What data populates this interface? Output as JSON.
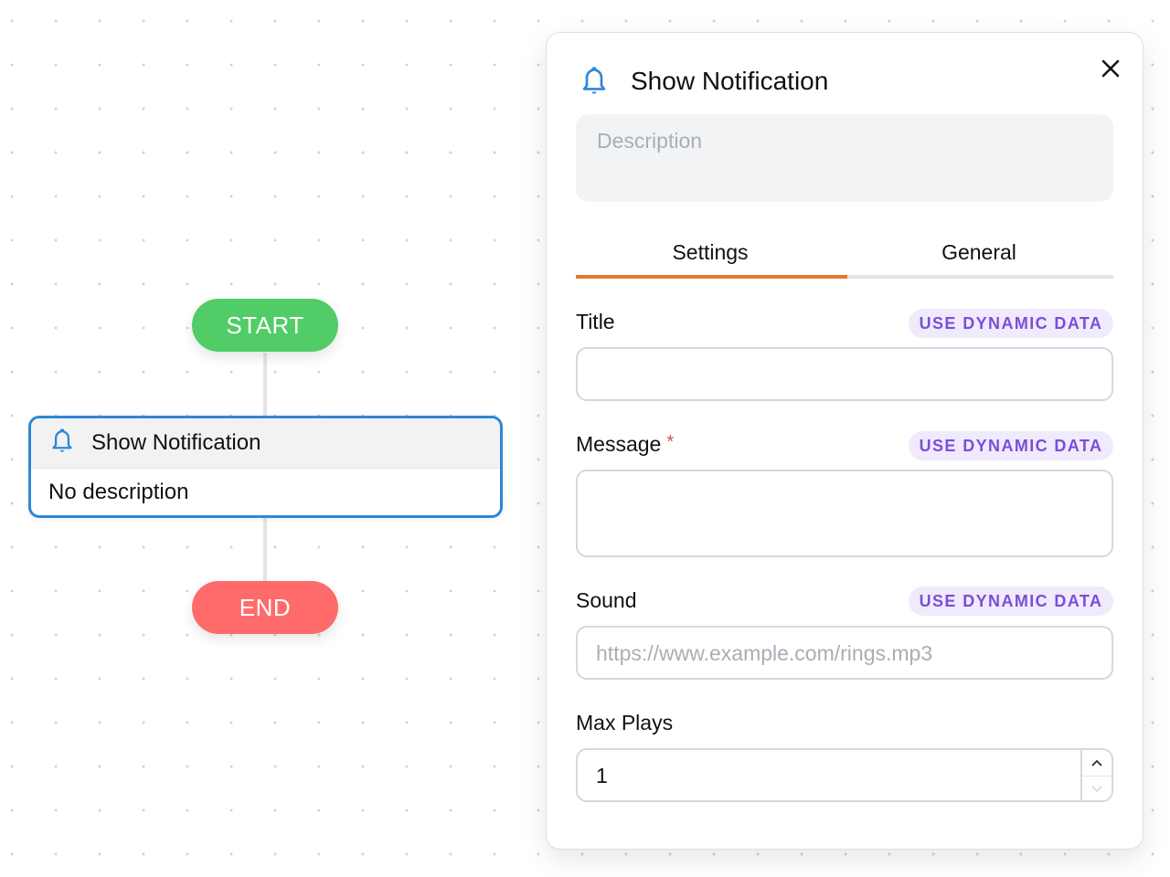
{
  "canvas": {
    "start_label": "START",
    "end_label": "END",
    "node": {
      "title": "Show Notification",
      "description": "No description",
      "icon": "bell-icon"
    }
  },
  "panel": {
    "title": "Show Notification",
    "icon": "bell-icon",
    "close_icon": "close-icon",
    "description_placeholder": "Description",
    "description_value": "",
    "tabs": [
      {
        "label": "Settings",
        "active": true
      },
      {
        "label": "General",
        "active": false
      }
    ],
    "fields": {
      "title": {
        "label": "Title",
        "value": "",
        "dynamic_label": "USE DYNAMIC DATA"
      },
      "message": {
        "label": "Message",
        "required_mark": "*",
        "value": "",
        "dynamic_label": "USE DYNAMIC DATA"
      },
      "sound": {
        "label": "Sound",
        "placeholder": "https://www.example.com/rings.mp3",
        "value": "",
        "dynamic_label": "USE DYNAMIC DATA"
      },
      "max_plays": {
        "label": "Max Plays",
        "value": "1"
      }
    }
  },
  "colors": {
    "start": "#52cc67",
    "end": "#ff6b6b",
    "node_border": "#2f86d8",
    "tab_active": "#e8772e",
    "tab_inactive": "#e2e3e6",
    "dynamic_text": "#7a4fd6",
    "dynamic_bg": "#f0eafd",
    "required": "#e5484d"
  }
}
